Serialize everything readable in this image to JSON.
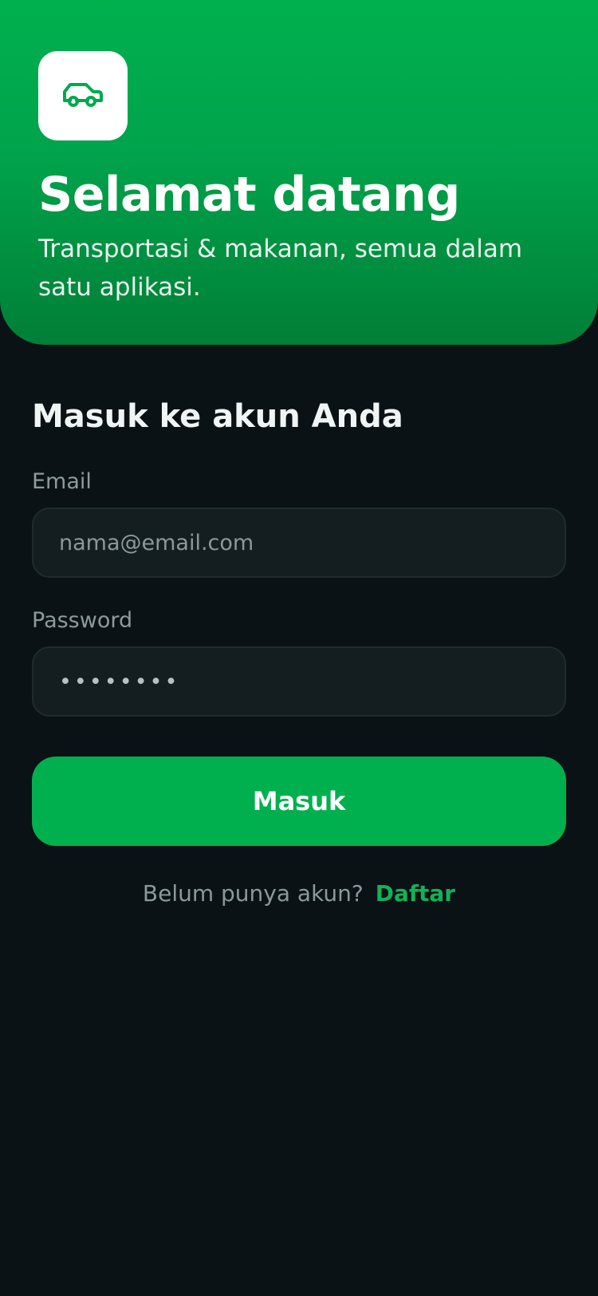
{
  "colors": {
    "brand": "#00b04f",
    "background": "#0b1215",
    "input_background": "#141e21",
    "link": "#12b257"
  },
  "hero": {
    "logo_icon": "car-icon",
    "title": "Selamat datang",
    "subtitle": "Transportasi & makanan, semua dalam satu aplikasi."
  },
  "form": {
    "title": "Masuk ke akun Anda",
    "email_label": "Email",
    "email_placeholder": "nama@email.com",
    "email_value": "",
    "password_label": "Password",
    "password_value": "••••••••",
    "submit_label": "Masuk"
  },
  "footer": {
    "prompt": "Belum punya akun?",
    "register_label": "Daftar"
  }
}
